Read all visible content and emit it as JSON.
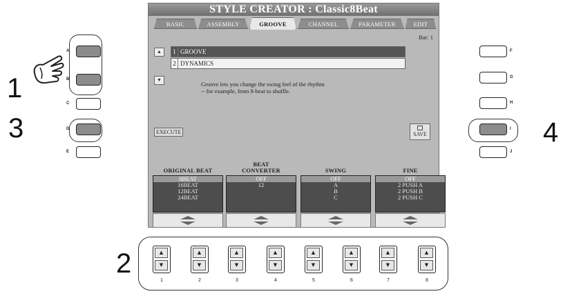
{
  "screen": {
    "title": "STYLE CREATOR : Classic8Beat",
    "tabs": [
      {
        "label": "BASIC"
      },
      {
        "label": "ASSEMBLY"
      },
      {
        "label": "GROOVE"
      },
      {
        "label": "CHANNEL"
      },
      {
        "label": "PARAMETER"
      },
      {
        "label": "EDIT"
      }
    ],
    "active_tab": "GROOVE",
    "bar": "Bar:  1",
    "list": [
      {
        "num": "1",
        "label": "GROOVE",
        "selected": true
      },
      {
        "num": "2",
        "label": "DYNAMICS",
        "selected": false
      }
    ],
    "description": [
      "Groove lets you change the swing feel of the rhythm",
      "-- for example, from 8-beat to shuffle."
    ],
    "execute_label": "EXECUTE",
    "save_label": "SAVE",
    "params": [
      {
        "label": [
          "",
          "ORIGINAL BEAT"
        ],
        "options": [
          "8BEAT",
          "16BEAT",
          "12BEAT",
          "24BEAT"
        ],
        "selected": 0
      },
      {
        "label": [
          "BEAT",
          "CONVERTER"
        ],
        "options": [
          "OFF",
          "12"
        ],
        "selected": 0
      },
      {
        "label": [
          "",
          "SWING"
        ],
        "options": [
          "OFF",
          "A",
          "B",
          "C"
        ],
        "selected": 0
      },
      {
        "label": [
          "",
          "FINE"
        ],
        "options": [
          "OFF",
          "2 PUSH A",
          "2 PUSH B",
          "2 PUSH C"
        ],
        "selected": 0
      }
    ]
  },
  "left_buttons": [
    "A",
    "B",
    "C",
    "D",
    "E"
  ],
  "right_buttons": [
    "F",
    "G",
    "H",
    "I",
    "J"
  ],
  "pressed_buttons": [
    "A",
    "B",
    "D",
    "I"
  ],
  "step_numbers": [
    "1",
    "2",
    "3",
    "4"
  ],
  "pad_numbers": [
    "1",
    "2",
    "3",
    "4",
    "5",
    "6",
    "7",
    "8"
  ],
  "icons": {
    "up": "▲",
    "down": "▼"
  }
}
